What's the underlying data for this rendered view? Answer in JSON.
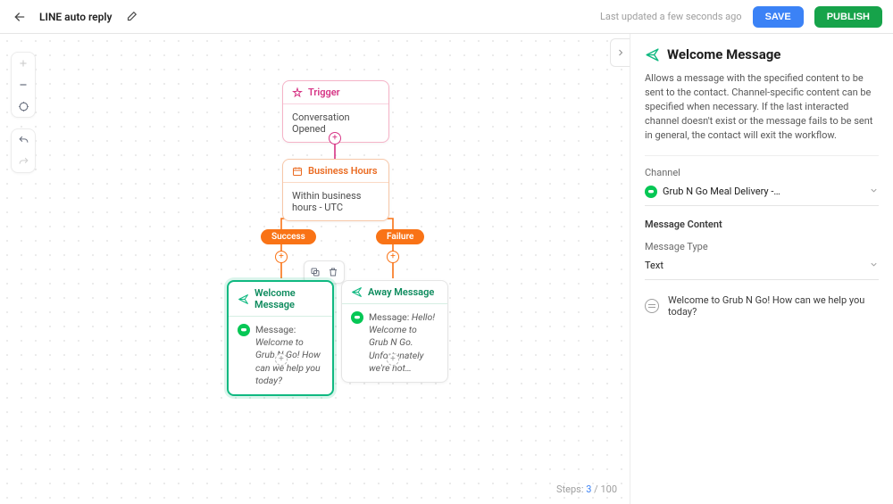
{
  "header": {
    "title": "LINE auto reply",
    "updated": "Last updated a few seconds ago",
    "save": "SAVE",
    "publish": "PUBLISH"
  },
  "steps": {
    "label": "Steps:",
    "current": "3",
    "sep": "/",
    "max": "100"
  },
  "nodes": {
    "trigger": {
      "title": "Trigger",
      "body": "Conversation Opened"
    },
    "bh": {
      "title": "Business Hours",
      "body": "Within business hours - UTC"
    },
    "branches": {
      "success": "Success",
      "failure": "Failure"
    },
    "welcome": {
      "title": "Welcome Message",
      "prefix": "Message: ",
      "text": "Welcome to Grub N Go! How can we help  you today?"
    },
    "away": {
      "title": "Away Message",
      "prefix": "Message: ",
      "text": "Hello! Welcome to Grub N Go. Unfortunately we're not…"
    }
  },
  "sidebar": {
    "title": "Welcome Message",
    "description": "Allows a message with the specified content to be sent to the contact. Channel-specific content can be specified when necessary. If the last interacted channel doesn't exist or the message fails to be sent in general, the contact will exit the workflow.",
    "channel_label": "Channel",
    "channel_value": "Grub N Go Meal Delivery -…",
    "content_section": "Message Content",
    "type_label": "Message Type",
    "type_value": "Text",
    "message_text": "Welcome to Grub N Go! How can we help you today?"
  },
  "icons": {
    "back": "arrow-left",
    "edit": "pencil",
    "zoom_in": "plus",
    "zoom_out": "minus",
    "fit": "target",
    "undo": "undo",
    "redo": "redo",
    "collapse": "chevron-right",
    "copy": "copy",
    "delete": "trash"
  }
}
